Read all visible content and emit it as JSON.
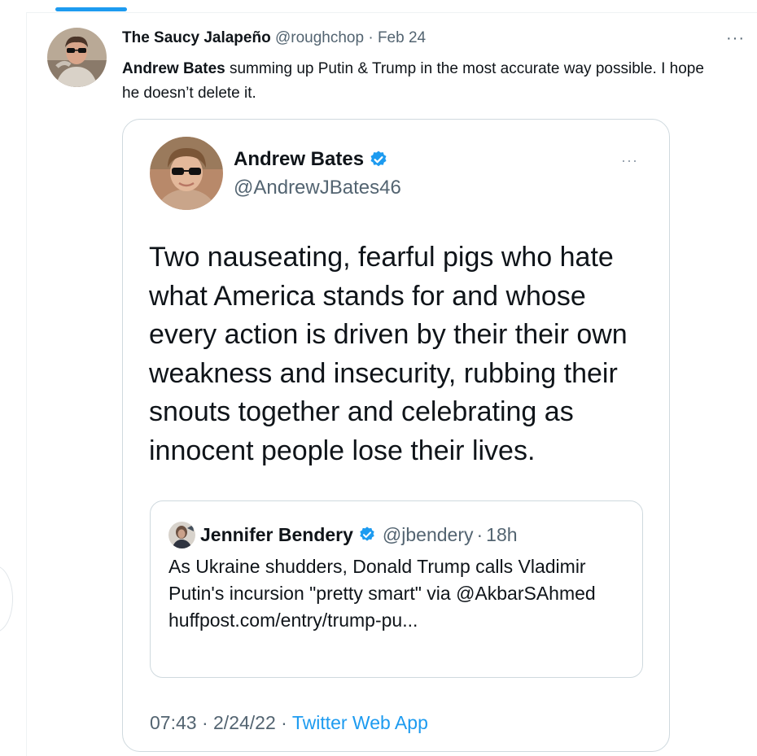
{
  "tweet": {
    "author_name": "The Saucy Jalapeño",
    "author_handle": "@roughchop",
    "separator": "·",
    "date": "Feb 24",
    "more_label": "···",
    "text_mention": "Andrew Bates",
    "text_rest": " summing up Putin & Trump in the most accurate way possible. I hope he doesn’t delete it."
  },
  "embedded": {
    "author_name": "Andrew Bates",
    "author_handle": "@AndrewJBates46",
    "more_label": "···",
    "text": "Two nauseating, fearful pigs who hate what America stands for and whose every action is driven by their their own weakness and insecurity, rubbing their snouts together and celebrating as innocent people lose their lives.",
    "time": "07:43",
    "date": "2/24/22",
    "separator": "·",
    "source": "Twitter Web App"
  },
  "quoted": {
    "author_name": "Jennifer Bendery",
    "author_handle": "@jbendery",
    "separator": "·",
    "age": "18h",
    "text": "As Ukraine shudders, Donald Trump calls Vladimir Putin's incursion \"pretty smart\" via @AkbarSAhmed  huffpost.com/entry/trump-pu..."
  },
  "icons": {
    "verified": "verified-badge-icon",
    "more": "more-options-icon"
  },
  "colors": {
    "accent": "#1d9bf0",
    "muted_text": "#536471",
    "border": "#cfd9de"
  }
}
